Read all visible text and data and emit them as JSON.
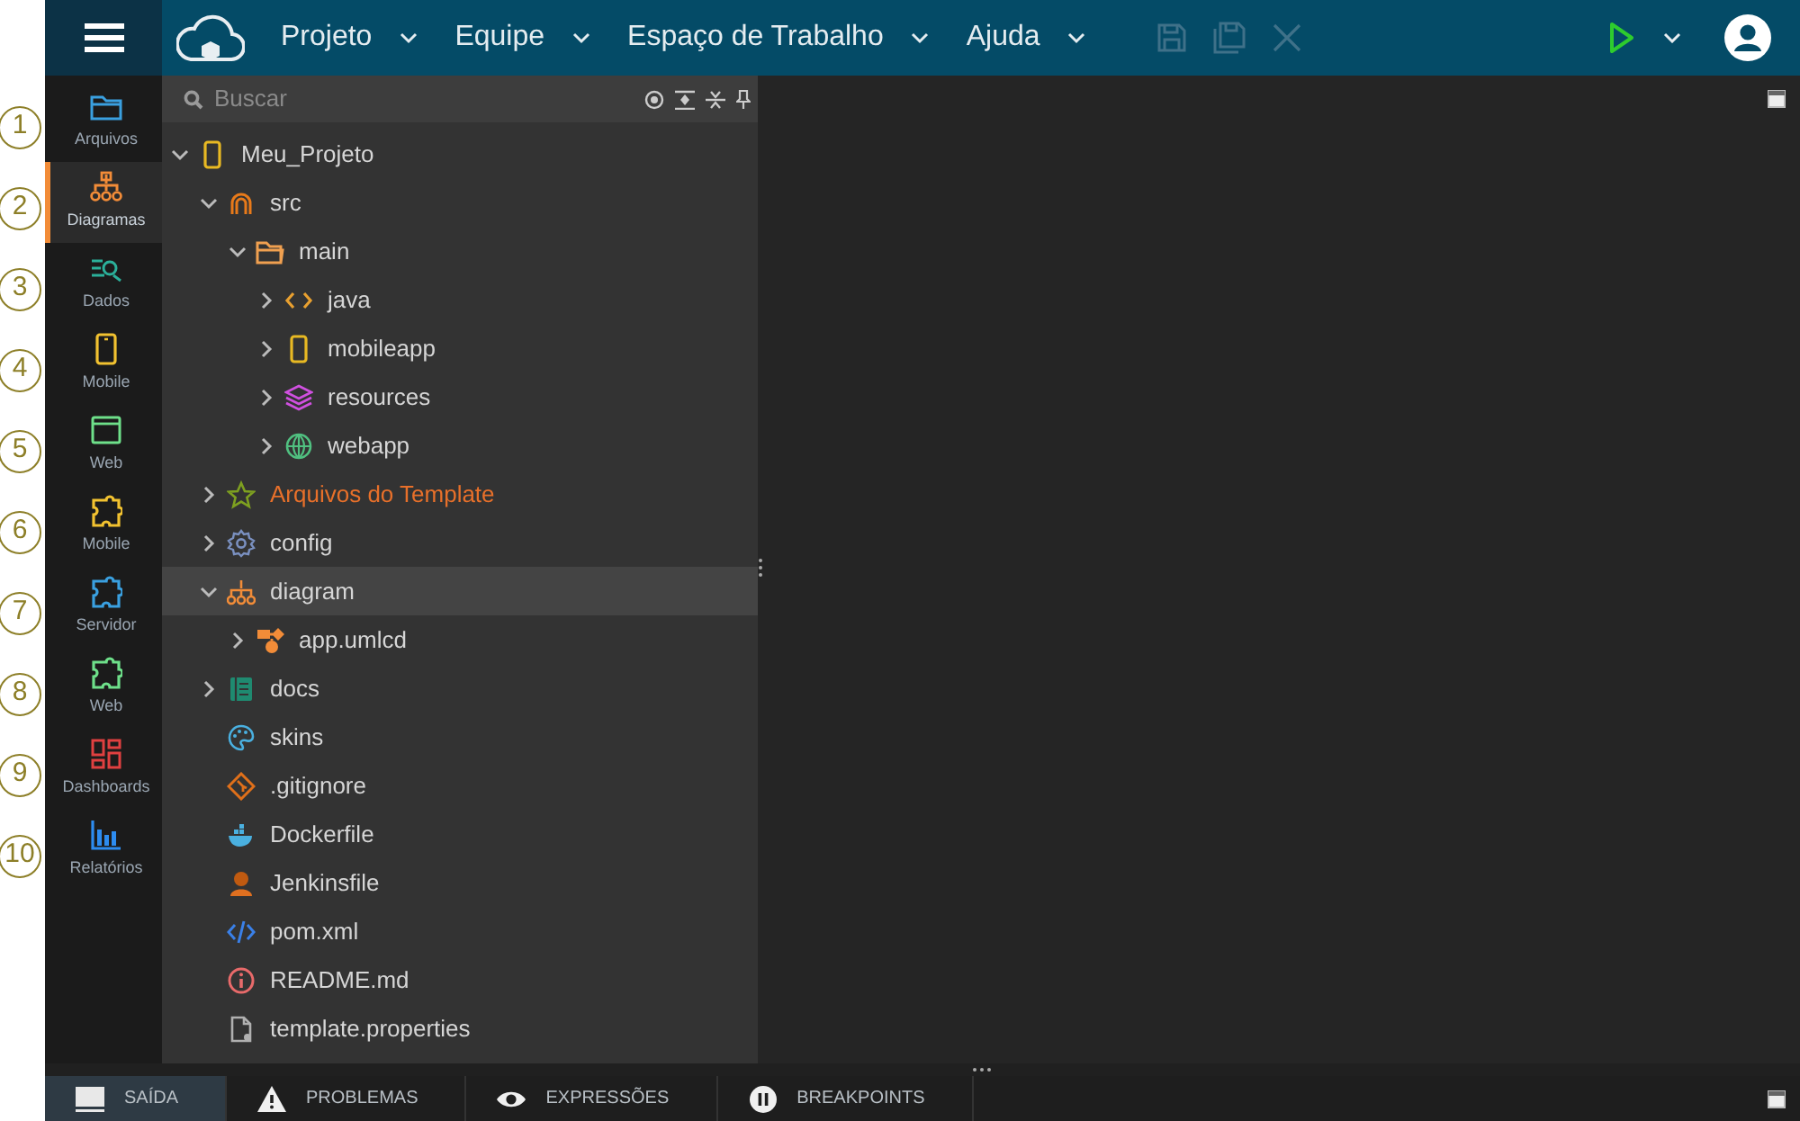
{
  "callouts": [
    "1",
    "2",
    "3",
    "4",
    "5",
    "6",
    "7",
    "8",
    "9",
    "10"
  ],
  "menu": [
    {
      "label": "Projeto"
    },
    {
      "label": "Equipe"
    },
    {
      "label": "Espaço de Trabalho"
    },
    {
      "label": "Ajuda"
    }
  ],
  "toolbar": [
    {
      "kind": "save",
      "disabled": true
    },
    {
      "kind": "save-all",
      "disabled": true
    },
    {
      "kind": "close",
      "disabled": true
    }
  ],
  "sidebar": [
    {
      "label": "Arquivos",
      "kind": "files",
      "selected": false
    },
    {
      "label": "Diagramas",
      "kind": "diagrams",
      "selected": true
    },
    {
      "label": "Dados",
      "kind": "data",
      "selected": false
    },
    {
      "label": "Mobile",
      "kind": "mobile",
      "selected": false
    },
    {
      "label": "Web",
      "kind": "web",
      "selected": false
    },
    {
      "label": "Mobile",
      "kind": "plugin-mobile",
      "selected": false
    },
    {
      "label": "Servidor",
      "kind": "plugin-server",
      "selected": false
    },
    {
      "label": "Web",
      "kind": "plugin-web",
      "selected": false
    },
    {
      "label": "Dashboards",
      "kind": "dashboards",
      "selected": false
    },
    {
      "label": "Relatórios",
      "kind": "reports",
      "selected": false
    }
  ],
  "search": {
    "placeholder": "Buscar"
  },
  "tree": [
    {
      "label": "Meu_Projeto",
      "kind": "mobile",
      "expanded": true,
      "selected": false,
      "children": [
        {
          "label": "src",
          "kind": "source",
          "expanded": true,
          "selected": false,
          "children": [
            {
              "label": "main",
              "kind": "folder",
              "expanded": true,
              "selected": false,
              "children": [
                {
                  "label": "java",
                  "kind": "code",
                  "expanded": false,
                  "selected": false
                },
                {
                  "label": "mobileapp",
                  "kind": "mobile",
                  "expanded": false,
                  "selected": false
                },
                {
                  "label": "resources",
                  "kind": "layers",
                  "expanded": false,
                  "selected": false
                },
                {
                  "label": "webapp",
                  "kind": "globe",
                  "expanded": false,
                  "selected": false
                }
              ]
            }
          ]
        },
        {
          "label": "Arquivos do Template",
          "kind": "template",
          "expanded": false,
          "selected": false
        },
        {
          "label": "config",
          "kind": "settings",
          "expanded": false,
          "selected": false
        },
        {
          "label": "diagram",
          "kind": "diagram",
          "expanded": true,
          "selected": true,
          "children": [
            {
              "label": "app.umlcd",
              "kind": "uml",
              "expanded": false,
              "selected": false
            }
          ]
        },
        {
          "label": "docs",
          "kind": "book",
          "expanded": false,
          "selected": false
        },
        {
          "label": "skins",
          "kind": "palette",
          "selected": false
        },
        {
          "label": ".gitignore",
          "kind": "git",
          "selected": false
        },
        {
          "label": "Dockerfile",
          "kind": "docker",
          "selected": false
        },
        {
          "label": "Jenkinsfile",
          "kind": "jenkins",
          "selected": false
        },
        {
          "label": "pom.xml",
          "kind": "xml",
          "selected": false
        },
        {
          "label": "README.md",
          "kind": "info",
          "selected": false
        },
        {
          "label": "template.properties",
          "kind": "file",
          "selected": false
        }
      ]
    }
  ],
  "bottom_tabs": [
    {
      "label": "SAÍDA",
      "kind": "output",
      "selected": true
    },
    {
      "label": "PROBLEMAS",
      "kind": "problems",
      "selected": false
    },
    {
      "label": "EXPRESSÕES",
      "kind": "expressions",
      "selected": false
    },
    {
      "label": "BREAKPOINTS",
      "kind": "breakpoints",
      "selected": false
    }
  ]
}
